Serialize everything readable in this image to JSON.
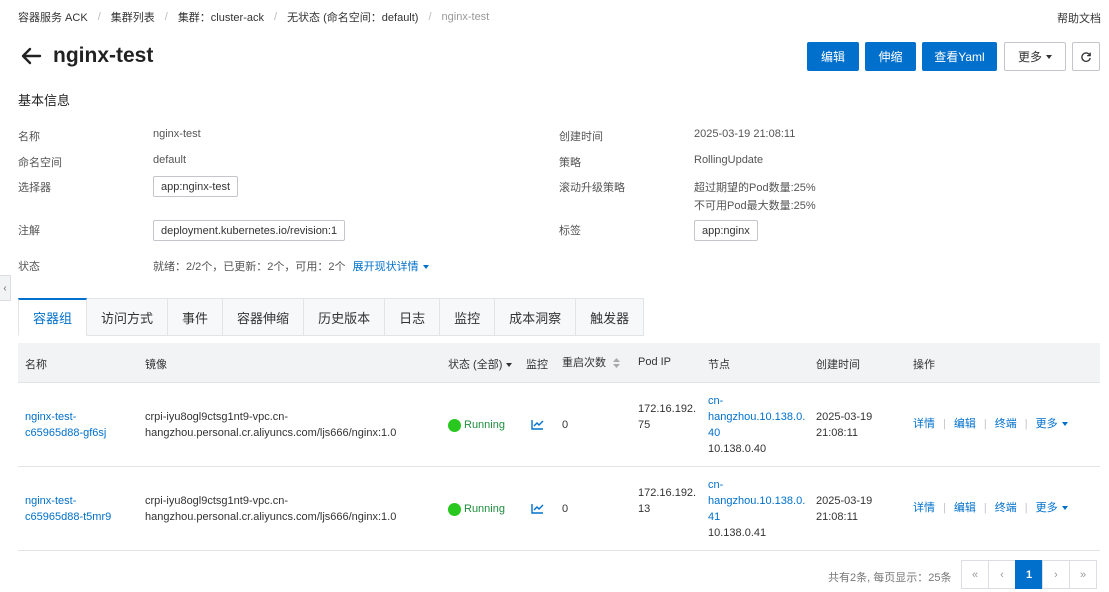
{
  "breadcrumb": [
    "容器服务 ACK",
    "集群列表",
    "集群：cluster-ack",
    "无状态 (命名空间：default)",
    "nginx-test"
  ],
  "help": "帮助文档",
  "title": "nginx-test",
  "actions": {
    "edit": "编辑",
    "scale": "伸缩",
    "yaml": "查看Yaml",
    "more": "更多"
  },
  "section_title": "基本信息",
  "info": {
    "name_label": "名称",
    "name": "nginx-test",
    "namespace_label": "命名空间",
    "namespace": "default",
    "selector_label": "选择器",
    "selector": "app:nginx-test",
    "annotation_label": "注解",
    "annotation": "deployment.kubernetes.io/revision:1",
    "status_label": "状态",
    "status": "就绪：2/2个，已更新：2个，可用：2个",
    "status_link": "展开现状详情",
    "created_label": "创建时间",
    "created": "2025-03-19 21:08:11",
    "strategy_label": "策略",
    "strategy": "RollingUpdate",
    "rolling_label": "滚动升级策略",
    "rolling_1": "超过期望的Pod数量:25%",
    "rolling_2": "不可用Pod最大数量:25%",
    "labels_label": "标签",
    "labels": "app:nginx"
  },
  "tabs": [
    "容器组",
    "访问方式",
    "事件",
    "容器伸缩",
    "历史版本",
    "日志",
    "监控",
    "成本洞察",
    "触发器"
  ],
  "table": {
    "headers": {
      "name": "名称",
      "image": "镜像",
      "status": "状态 (全部)",
      "monitor": "监控",
      "restarts": "重启次数",
      "pod_ip": "Pod IP",
      "node": "节点",
      "created": "创建时间",
      "ops": "操作"
    },
    "rows": [
      {
        "name_1": "nginx-test-",
        "name_2": "c65965d88-gf6sj",
        "image_1": "crpi-iyu8ogl9ctsg1nt9-vpc.cn-",
        "image_2": "hangzhou.personal.cr.aliyuncs.com/ljs666/nginx:1.0",
        "status": "Running",
        "restarts": "0",
        "ip_1": "172.16.192.",
        "ip_2": "75",
        "node_1": "cn-",
        "node_2": "hangzhou.10.138.0.",
        "node_3": "40",
        "node_ip": "10.138.0.40",
        "created_1": "2025-03-19",
        "created_2": "21:08:11",
        "op_detail": "详情",
        "op_edit": "编辑",
        "op_terminate": "终端",
        "op_more": "更多"
      },
      {
        "name_1": "nginx-test-",
        "name_2": "c65965d88-t5mr9",
        "image_1": "crpi-iyu8ogl9ctsg1nt9-vpc.cn-",
        "image_2": "hangzhou.personal.cr.aliyuncs.com/ljs666/nginx:1.0",
        "status": "Running",
        "restarts": "0",
        "ip_1": "172.16.192.",
        "ip_2": "13",
        "node_1": "cn-",
        "node_2": "hangzhou.10.138.0.",
        "node_3": "41",
        "node_ip": "10.138.0.41",
        "created_1": "2025-03-19",
        "created_2": "21:08:11",
        "op_detail": "详情",
        "op_edit": "编辑",
        "op_terminate": "终端",
        "op_more": "更多"
      }
    ]
  },
  "pagination": {
    "info": "共有2条, 每页显示：25条",
    "first": "«",
    "prev": "‹",
    "page": "1",
    "next": "›",
    "last": "»"
  },
  "colors": {
    "accent": "#0070cc",
    "running": "#28c81e"
  }
}
